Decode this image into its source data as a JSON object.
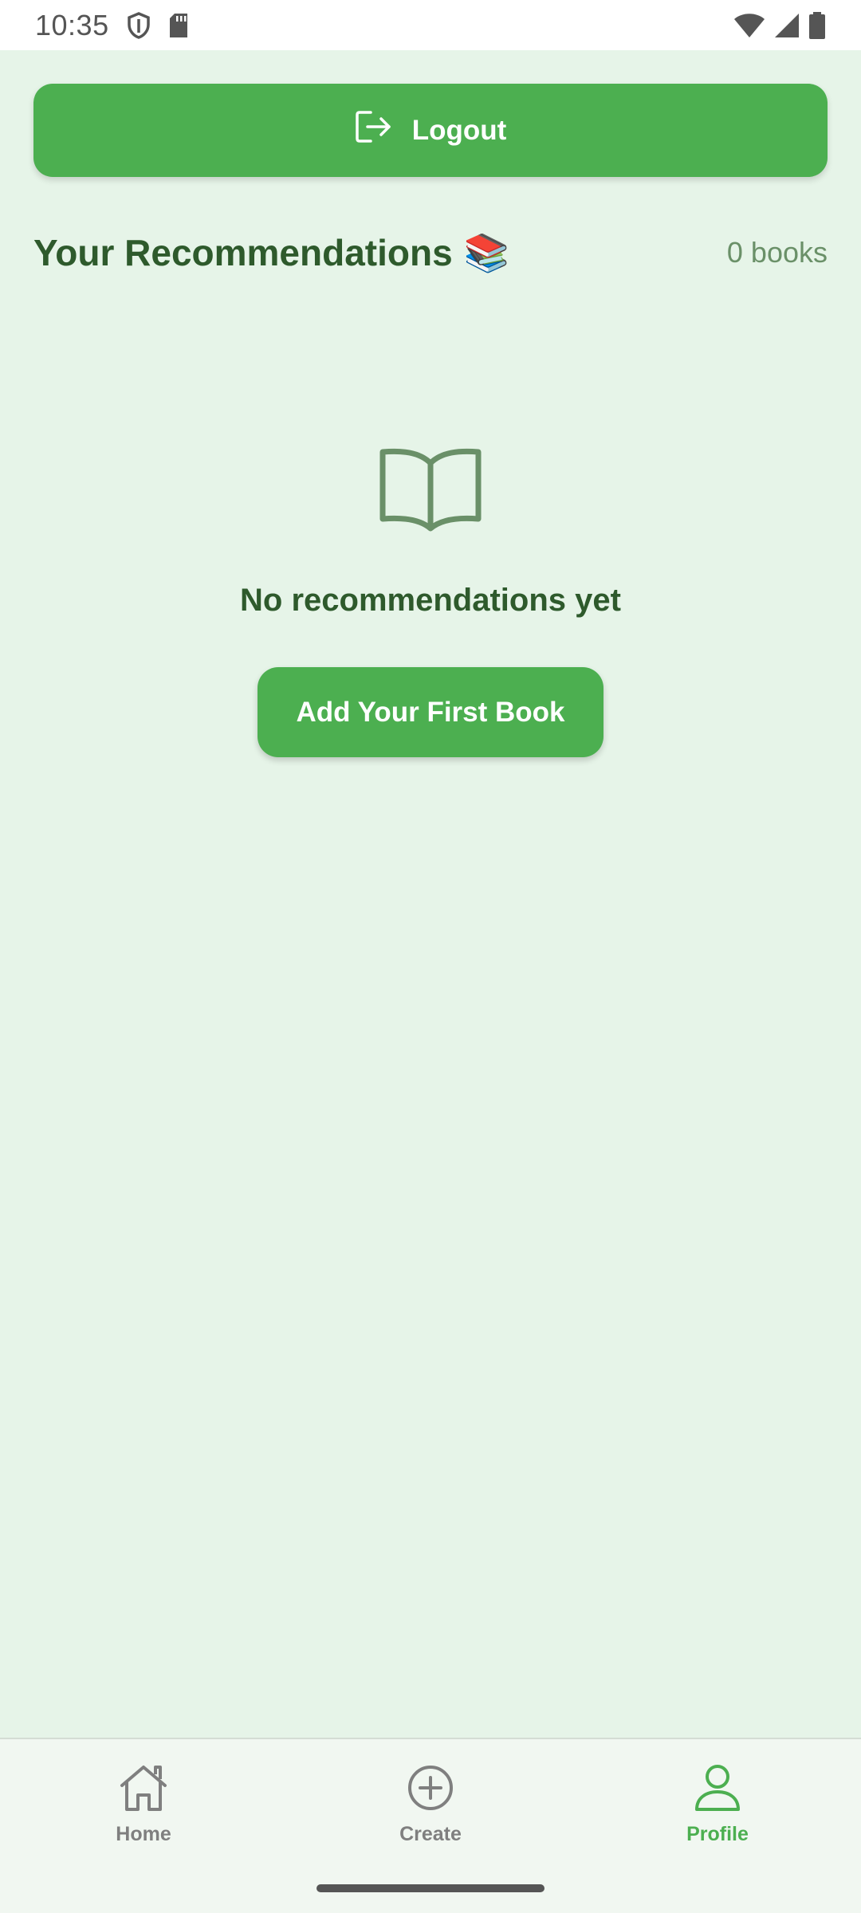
{
  "status_bar": {
    "time": "10:35"
  },
  "header": {
    "logout_label": "Logout"
  },
  "recommendations": {
    "title": "Your Recommendations",
    "emoji": "📚",
    "count_text": "0 books",
    "empty_message": "No recommendations yet",
    "add_button_label": "Add Your First Book"
  },
  "bottom_nav": {
    "items": [
      {
        "label": "Home",
        "icon": "home-icon",
        "active": false
      },
      {
        "label": "Create",
        "icon": "plus-circle-icon",
        "active": false
      },
      {
        "label": "Profile",
        "icon": "person-icon",
        "active": true
      }
    ]
  },
  "colors": {
    "accent": "#4caf50",
    "background": "#e6f4e8",
    "title_text": "#2e5a2c",
    "muted_text": "#6a9068",
    "inactive_nav": "#7f7f7f"
  }
}
